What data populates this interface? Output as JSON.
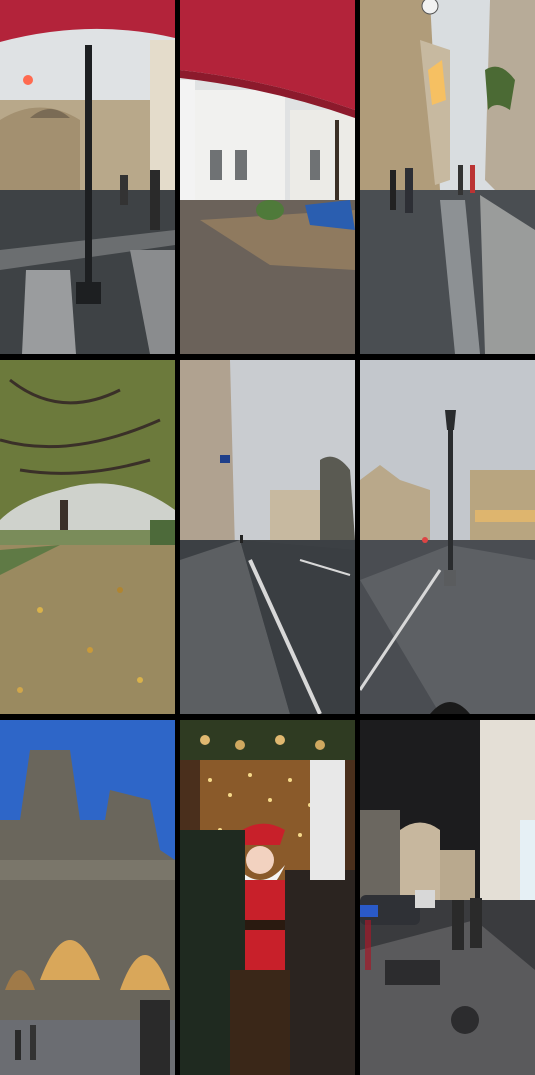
{
  "collage": {
    "layout": "3x3 grid",
    "photos": [
      {
        "subject": "street-lamp-with-umbrella-view"
      },
      {
        "subject": "umbrella-over-cobblestone-courtyard"
      },
      {
        "subject": "wet-narrow-street-with-christmas-lights"
      },
      {
        "subject": "park-with-fallen-autumn-leaves"
      },
      {
        "subject": "wide-wet-boulevard"
      },
      {
        "subject": "bridge-with-street-lamp-at-dusk"
      },
      {
        "subject": "notre-dame-cathedral-facade-at-dusk"
      },
      {
        "subject": "santa-claus-with-fairy-lights"
      },
      {
        "subject": "night-street-with-shops-and-cars"
      }
    ]
  },
  "colors": {
    "background": "#000000",
    "umbrella_red": "#b3233a",
    "overcast_sky": "#d9dde0",
    "evening_sky": "#2e66c8",
    "warm_light": "#f6c062"
  }
}
